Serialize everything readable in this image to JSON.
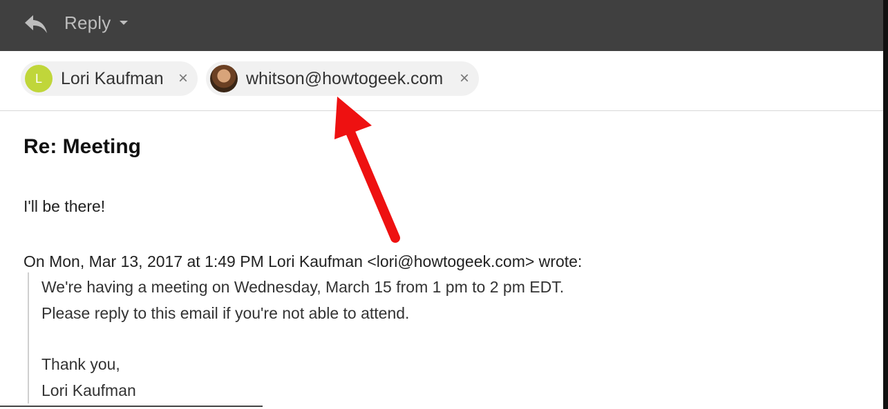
{
  "header": {
    "reply_label": "Reply",
    "reply_icon": "reply-arrow-icon",
    "dropdown_icon": "caret-down-icon"
  },
  "recipients": [
    {
      "avatar_letter": "L",
      "name": "Lori Kaufman",
      "close": "×",
      "avatar_color": "#c0d63a"
    },
    {
      "avatar_letter": "",
      "name": "whitson@howtogeek.com",
      "close": "×"
    }
  ],
  "email": {
    "subject": "Re: Meeting",
    "reply_body": "I'll be there!",
    "quote_header": "On Mon, Mar 13, 2017 at 1:49 PM Lori Kaufman <lori@howtogeek.com> wrote:",
    "quote_lines": [
      "We're having a meeting on Wednesday, March 15 from 1 pm to 2 pm EDT.",
      "Please reply to this email if you're not able to attend.",
      "Thank you,",
      "Lori Kaufman"
    ]
  },
  "colors": {
    "header_bg": "#404040",
    "annotation_arrow": "#ee1111"
  }
}
